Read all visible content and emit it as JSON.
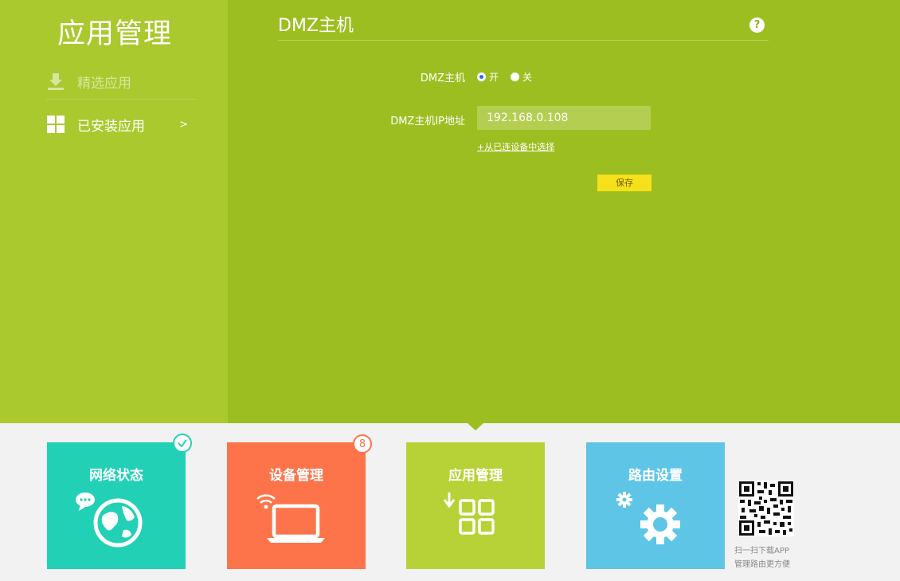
{
  "sidebar": {
    "title": "应用管理",
    "items": [
      {
        "label": "精选应用",
        "icon": "download-icon"
      },
      {
        "label": "已安装应用",
        "icon": "grid-icon",
        "arrow": ">"
      }
    ]
  },
  "main": {
    "title": "DMZ主机",
    "help_icon": "?",
    "dmz_label": "DMZ主机",
    "options": {
      "on": "开",
      "off": "关",
      "selected": "on"
    },
    "ip_label": "DMZ主机IP地址",
    "ip_value": "192.168.0.108",
    "link_label": "+从已连设备中选择",
    "save_label": "保存"
  },
  "tiles": [
    {
      "label": "网络状态",
      "color": "#22d1b5",
      "icon": "globe-chat-icon",
      "badge": "check"
    },
    {
      "label": "设备管理",
      "color": "#fe744a",
      "icon": "laptop-wifi-icon",
      "badge": "8"
    },
    {
      "label": "应用管理",
      "color": "#b7d236",
      "icon": "apps-grid-icon"
    },
    {
      "label": "路由设置",
      "color": "#5ec5e7",
      "icon": "gears-icon"
    }
  ],
  "qr": {
    "line1": "扫一扫下载APP",
    "line2": "管理路由更方便"
  },
  "colors": {
    "main_bg": "#9dbe21",
    "sidebar_bg": "#a9c92e",
    "save_button": "#f6e11b"
  }
}
